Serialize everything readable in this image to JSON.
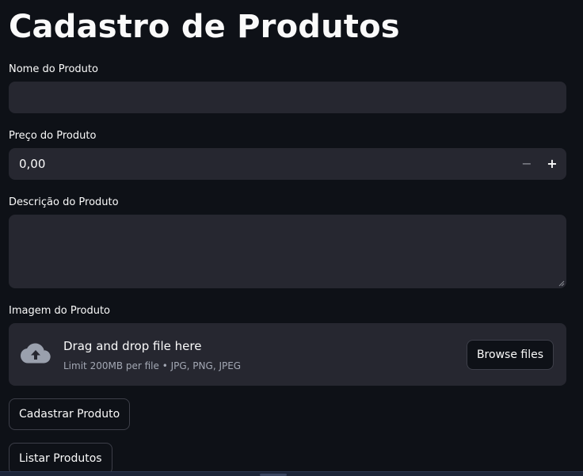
{
  "page": {
    "title": "Cadastro de Produtos"
  },
  "form": {
    "name": {
      "label": "Nome do Produto",
      "value": ""
    },
    "price": {
      "label": "Preço do Produto",
      "value": "0,00",
      "minus_symbol": "−",
      "plus_symbol": "+"
    },
    "description": {
      "label": "Descrição do Produto",
      "value": ""
    },
    "image": {
      "label": "Imagem do Produto",
      "drop_text": "Drag and drop file here",
      "limit_text": "Limit 200MB per file • JPG, PNG, JPEG",
      "browse_label": "Browse files",
      "icon": "cloud-upload-icon"
    }
  },
  "actions": {
    "submit_label": "Cadastrar Produto",
    "list_label": "Listar Produtos"
  },
  "colors": {
    "background": "#0e1117",
    "field": "#262730",
    "text": "#fafafa",
    "muted": "#a3a8b4",
    "border": "#3d3f49"
  }
}
